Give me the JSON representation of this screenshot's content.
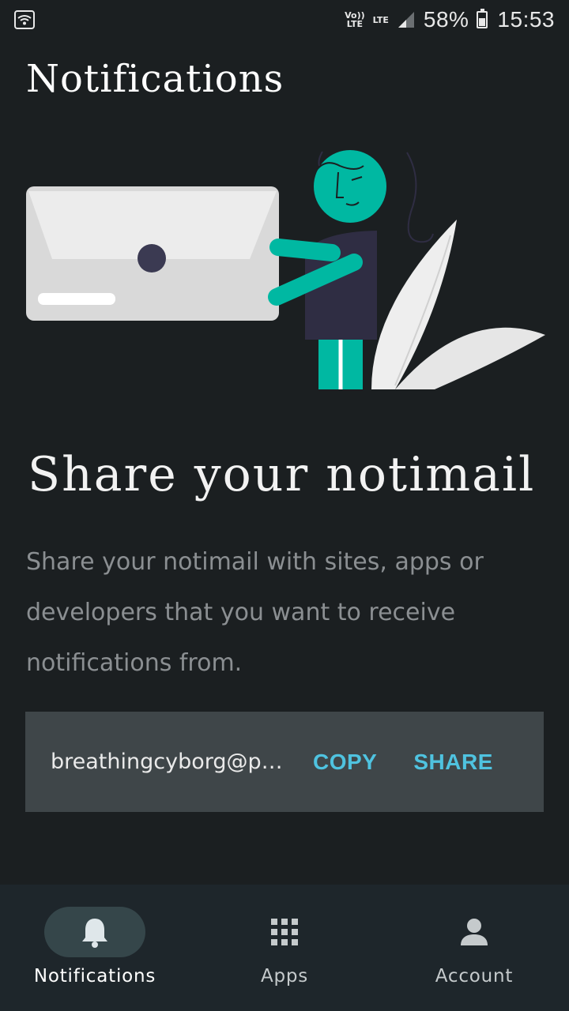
{
  "status_bar": {
    "volte_label": "Vo))\nLTE",
    "lte_label": "LTE",
    "battery": "58%",
    "time": "15:53",
    "icons": [
      "wifi-icon",
      "signal-icon",
      "battery-icon"
    ]
  },
  "page": {
    "title": "Notifications"
  },
  "main": {
    "headline": "Share your notimail",
    "description": "Share your notimail with sites, apps or developers that you want to receive notifications from.",
    "email": "breathingcyborg@pu...",
    "copy_label": "COPY",
    "share_label": "SHARE"
  },
  "nav": {
    "items": [
      {
        "label": "Notifications",
        "icon": "bell-icon",
        "active": true
      },
      {
        "label": "Apps",
        "icon": "apps-grid-icon",
        "active": false
      },
      {
        "label": "Account",
        "icon": "person-icon",
        "active": false
      }
    ]
  },
  "colors": {
    "background": "#1b1f21",
    "accent": "#4fc3e0",
    "card": "#3f4649",
    "nav_background": "#1e262b",
    "teal": "#00b8a2"
  }
}
